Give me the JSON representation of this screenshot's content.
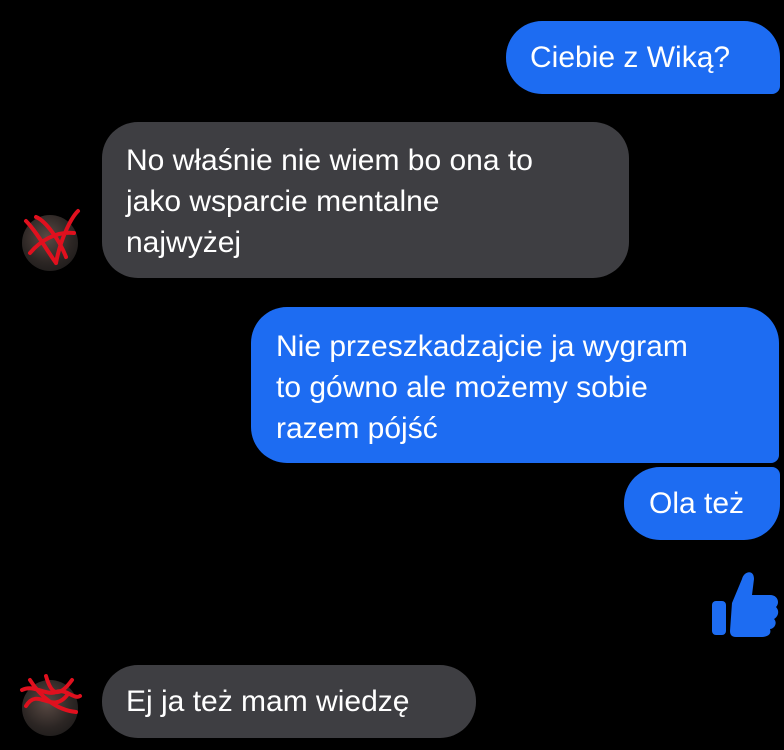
{
  "conversation": {
    "messages": [
      {
        "sender": "me",
        "text": "Ciebie z Wiką?"
      },
      {
        "sender": "them",
        "text": "No właśnie nie wiem bo ona to\njako wsparcie mentalne\nnajwyżej"
      },
      {
        "sender": "me",
        "text": "Nie przeszkadzajcie ja wygram\nto gówno ale możemy sobie\nrazem pójść"
      },
      {
        "sender": "me",
        "text": "Ola też"
      },
      {
        "sender": "me",
        "reaction": "thumbs-up-icon"
      },
      {
        "sender": "them",
        "text": "Ej ja też mam wiedzę"
      }
    ]
  },
  "colors": {
    "background": "#000000",
    "outgoing_bubble": "#1d6cf2",
    "incoming_bubble": "#3e3e42",
    "text": "#ffffff",
    "avatar_scribble": "#e0101e"
  }
}
